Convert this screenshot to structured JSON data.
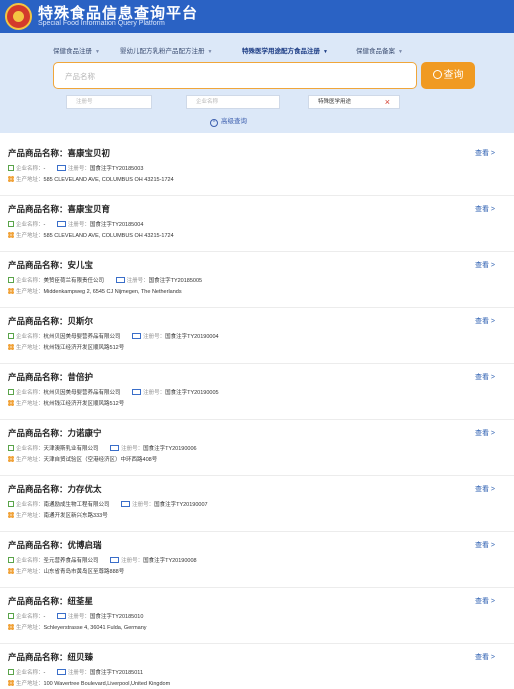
{
  "header": {
    "title": "特殊食品信息查询平台",
    "subtitle": "Special Food Information Query Platform"
  },
  "search": {
    "tabs": [
      {
        "label": "保健食品注册"
      },
      {
        "label": "婴幼儿配方乳粉产品配方注册"
      },
      {
        "label": "特殊医学用途配方食品注册"
      },
      {
        "label": "保健食品备案"
      }
    ],
    "main_placeholder": "产品名称",
    "button_label": "查询",
    "reg_placeholder": "注册号",
    "company_placeholder": "企业名称",
    "type_value": "特殊医学用途",
    "clear_symbol": "×",
    "advanced_label": "高级查询"
  },
  "labels": {
    "name_prefix": "产品商品名称：",
    "company": "企业名称：",
    "reg": "注册号：",
    "addr": "生产地址：",
    "view": "查看 >"
  },
  "results": [
    {
      "name": "喜康宝贝初",
      "company": "-",
      "reg": "国食注字TY20185003",
      "addr": "585 CLEVELAND AVE, COLUMBUS OH 43215-1724"
    },
    {
      "name": "喜康宝贝育",
      "company": "-",
      "reg": "国食注字TY20185004",
      "addr": "585 CLEVELAND AVE, COLUMBUS OH 43215-1724"
    },
    {
      "name": "安儿宝",
      "company": "美赞臣荷兰有限责任公司",
      "reg": "国食注字TY20185005",
      "addr": "Middenkampweg 2, 6545 CJ Nijmegen, The Netherlands"
    },
    {
      "name": "贝斯尔",
      "company": "杭州贝因美母婴营养品有限公司",
      "reg": "国食注字TY20190004",
      "addr": "杭州钱江经济开发区顺风路512号"
    },
    {
      "name": "昔倍护",
      "company": "杭州贝因美母婴营养品有限公司",
      "reg": "国食注字TY20190005",
      "addr": "杭州钱江经济开发区顺风路512号"
    },
    {
      "name": "力诺康宁",
      "company": "天津澳斯乳业有限公司",
      "reg": "国食注字TY20190006",
      "addr": "天津自贸试验区（空港经济区）中环西路408号"
    },
    {
      "name": "力存优太",
      "company": "南通励成生物工程有限公司",
      "reg": "国食注字TY20190007",
      "addr": "南通开发区新兴东路333号"
    },
    {
      "name": "优博启瑞",
      "company": "圣元营养食品有限公司",
      "reg": "国食注字TY20190008",
      "addr": "山东省青岛市黄岛区至尊路888号"
    },
    {
      "name": "纽荃星",
      "company": "-",
      "reg": "国食注字TY20185010",
      "addr": "Schleyerstrasse 4, 36041 Fulda, Germany"
    },
    {
      "name": "纽贝臻",
      "company": "-",
      "reg": "国食注字TY20185011",
      "addr": "100 Wavertree Boulevard,Liverpool,United Kingdom"
    }
  ]
}
